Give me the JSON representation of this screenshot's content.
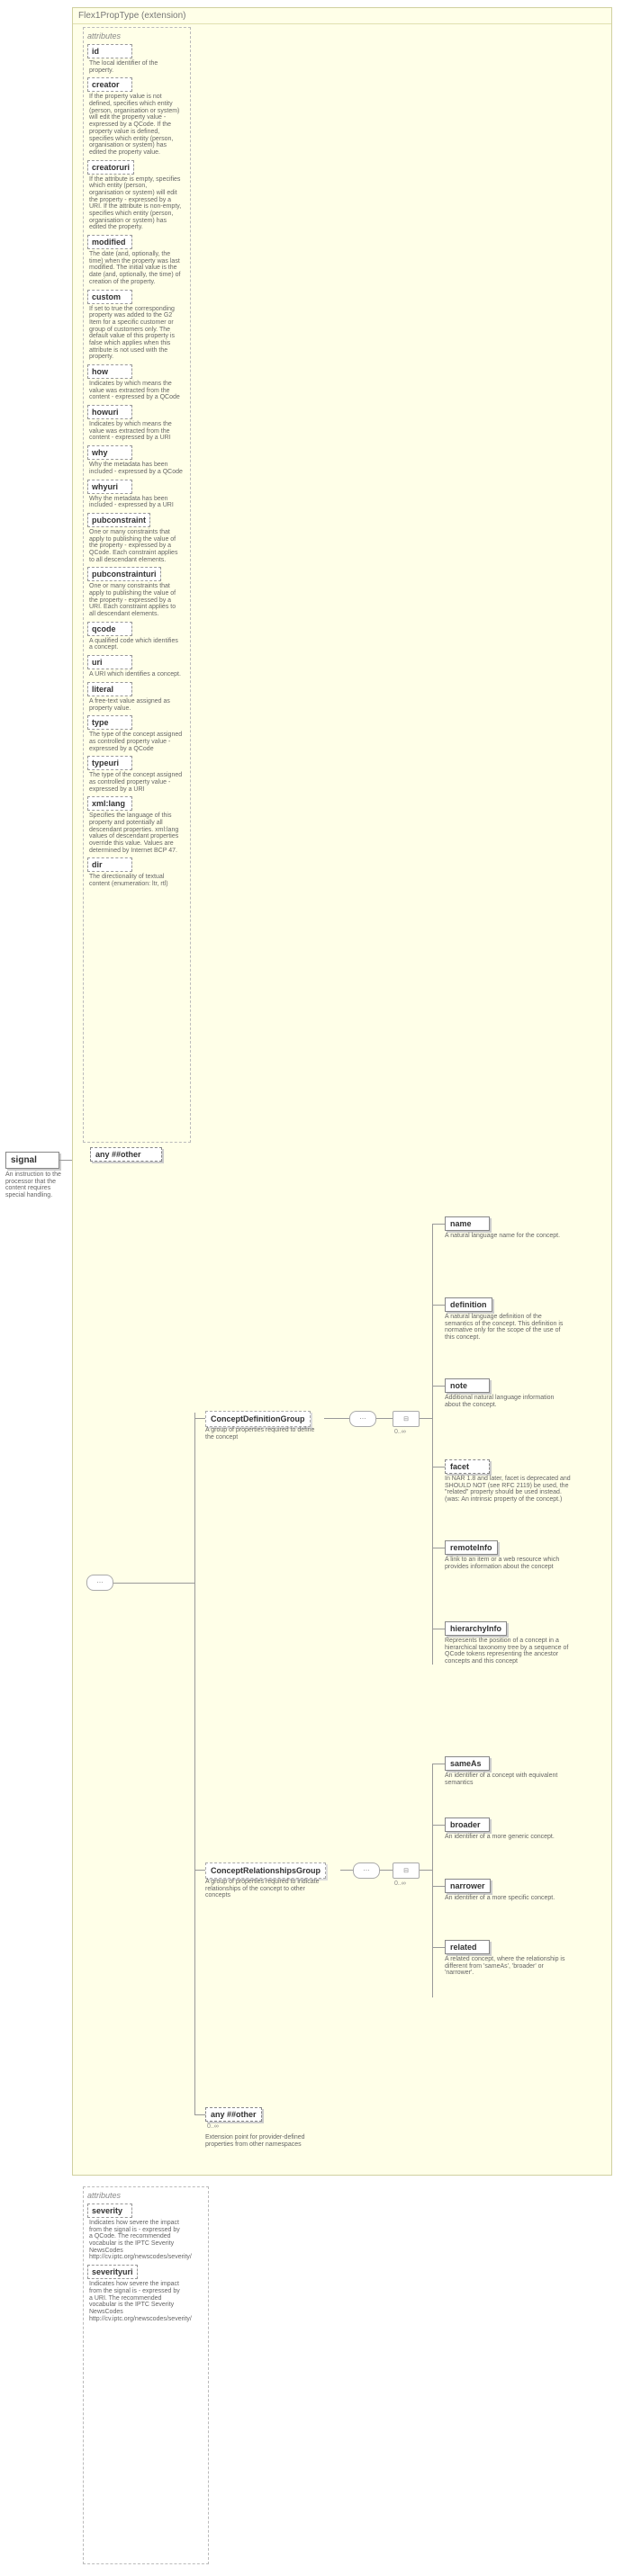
{
  "ext_header": "Flex1PropType (extension)",
  "root": {
    "name": "signal",
    "desc": "An instruction to the processor that the content requires special handling."
  },
  "attrs_label": "attributes",
  "attrs": [
    {
      "name": "id",
      "desc": "The local identifier of the property."
    },
    {
      "name": "creator",
      "desc": "If the property value is not defined, specifies which entity (person, organisation or system) will edit the property value - expressed by a QCode. If the property value is defined, specifies which entity (person, organisation or system) has edited the property value."
    },
    {
      "name": "creatoruri",
      "desc": "If the attribute is empty, specifies which entity (person, organisation or system) will edit the property - expressed by a URI. If the attribute is non-empty, specifies which entity (person, organisation or system) has edited the property."
    },
    {
      "name": "modified",
      "desc": "The date (and, optionally, the time) when the property was last modified. The initial value is the date (and, optionally, the time) of creation of the property."
    },
    {
      "name": "custom",
      "desc": "If set to true the corresponding property was added to the G2 Item for a specific customer or group of customers only. The default value of this property is false which applies when this attribute is not used with the property."
    },
    {
      "name": "how",
      "desc": "Indicates by which means the value was extracted from the content - expressed by a QCode"
    },
    {
      "name": "howuri",
      "desc": "Indicates by which means the value was extracted from the content - expressed by a URI"
    },
    {
      "name": "why",
      "desc": "Why the metadata has been included - expressed by a QCode"
    },
    {
      "name": "whyuri",
      "desc": "Why the metadata has been included - expressed by a URI"
    },
    {
      "name": "pubconstraint",
      "desc": "One or many constraints that apply to publishing the value of the property - expressed by a QCode. Each constraint applies to all descendant elements."
    },
    {
      "name": "pubconstrainturi",
      "desc": "One or many constraints that apply to publishing the value of the property - expressed by a URI. Each constraint applies to all descendant elements."
    },
    {
      "name": "qcode",
      "desc": "A qualified code which identifies a concept."
    },
    {
      "name": "uri",
      "desc": "A URI which identifies a concept."
    },
    {
      "name": "literal",
      "desc": "A free-text value assigned as property value."
    },
    {
      "name": "type",
      "desc": "The type of the concept assigned as controlled property value - expressed by a QCode"
    },
    {
      "name": "typeuri",
      "desc": "The type of the concept assigned as controlled property value - expressed by a URI"
    },
    {
      "name": "xml:lang",
      "desc": "Specifies the language of this property and potentially all descendant properties. xml:lang values of descendant properties override this value. Values are determined by Internet BCP 47."
    },
    {
      "name": "dir",
      "desc": "The directionality of textual content (enumeration: ltr, rtl)"
    }
  ],
  "any_other": "any ##other",
  "groups": {
    "def": {
      "name": "ConceptDefinitionGroup",
      "desc": "A group of properties required to define the concept"
    },
    "rel": {
      "name": "ConceptRelationshipsGroup",
      "desc": "A group of properties required to indicate relationships of the concept to other concepts"
    }
  },
  "def_children": [
    {
      "name": "name",
      "desc": "A natural language name for the concept."
    },
    {
      "name": "definition",
      "desc": "A natural language definition of the semantics of the concept. This definition is normative only for the scope of the use of this concept."
    },
    {
      "name": "note",
      "desc": "Additional natural language information about the concept."
    },
    {
      "name": "facet",
      "desc": "In NAR 1.8 and later, facet is deprecated and SHOULD NOT (see RFC 2119) be used, the \"related\" property should be used instead. (was: An intrinsic property of the concept.)",
      "dashed": true
    },
    {
      "name": "remoteInfo",
      "desc": "A link to an item or a web resource which provides information about the concept"
    },
    {
      "name": "hierarchyInfo",
      "desc": "Represents the position of a concept in a hierarchical taxonomy tree by a sequence of QCode tokens representing the ancestor concepts and this concept"
    }
  ],
  "rel_children": [
    {
      "name": "sameAs",
      "desc": "An identifier of a concept with equivalent semantics"
    },
    {
      "name": "broader",
      "desc": "An identifier of a more generic concept."
    },
    {
      "name": "narrower",
      "desc": "An identifier of a more specific concept."
    },
    {
      "name": "related",
      "desc": "A related concept, where the relationship is different from 'sameAs', 'broader' or 'narrower'."
    }
  ],
  "any_other2": {
    "name": "any ##other",
    "desc": "Extension point for provider-defined properties from other namespaces"
  },
  "occ": "0..∞",
  "attrs2_label": "attributes",
  "attrs2": [
    {
      "name": "severity",
      "desc": "Indicates how severe the impact from the signal is - expressed by a QCode. The recommended vocabular is the IPTC Severity NewsCodes http://cv.iptc.org/newscodes/severity/"
    },
    {
      "name": "severityuri",
      "desc": "Indicates how severe the impact from the signal is - expressed by a URI. The recommended vocabular is the IPTC Severity NewsCodes http://cv.iptc.org/newscodes/severity/"
    }
  ]
}
